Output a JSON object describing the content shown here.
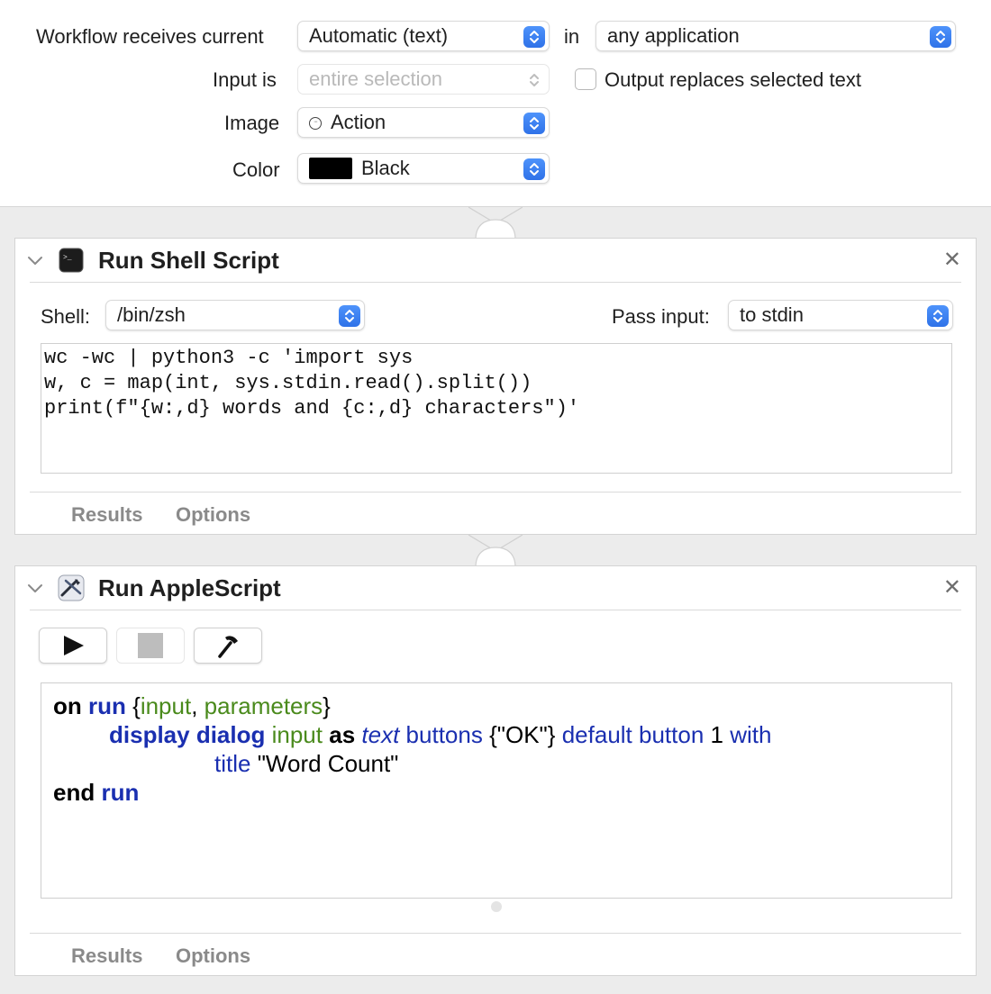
{
  "header": {
    "workflow_label": "Workflow receives current",
    "workflow_value": "Automatic (text)",
    "in_label": "in",
    "application_value": "any application",
    "input_label": "Input is",
    "input_value": "entire selection",
    "output_replaces_label": "Output replaces selected text",
    "output_replaces_checked": false,
    "image_label": "Image",
    "image_value": "Action",
    "image_icon": "action-icon",
    "color_label": "Color",
    "color_value": "Black",
    "color_swatch": "#000000"
  },
  "shell_action": {
    "title": "Run Shell Script",
    "icon": "terminal-icon",
    "shell_label": "Shell:",
    "shell_value": "/bin/zsh",
    "pass_input_label": "Pass input:",
    "pass_input_value": "to stdin",
    "script_lines": [
      "wc -wc | python3 -c 'import sys",
      "w, c = map(int, sys.stdin.read().split())",
      "print(f\"{w:,d} words and {c:,d} characters\")'"
    ],
    "tabs": [
      "Results",
      "Options"
    ]
  },
  "applescript_action": {
    "title": "Run AppleScript",
    "icon": "applescript-icon",
    "toolbar": [
      "run-icon",
      "stop-icon",
      "compile-icon"
    ],
    "code": {
      "line1": {
        "kw_on": "on",
        "handler": "run",
        "open": " {",
        "p1": "input",
        "comma": ", ",
        "p2": "parameters",
        "close": "}"
      },
      "line2": {
        "cmd": "display dialog",
        "arg": "input",
        "as": "as",
        "cls": "text",
        "buttons": "buttons",
        "list": "{\"OK\"}",
        "default": "default button",
        "num": "1",
        "with": "with"
      },
      "line3": {
        "title_kw": "title",
        "title_str": "\"Word Count\""
      },
      "line4": {
        "kw_end": "end",
        "handler": "run"
      }
    },
    "tabs": [
      "Results",
      "Options"
    ]
  },
  "colors": {
    "accent": "#3b82f6",
    "applescript_command": "#1a2fb0",
    "applescript_variable": "#4a8a1c"
  }
}
